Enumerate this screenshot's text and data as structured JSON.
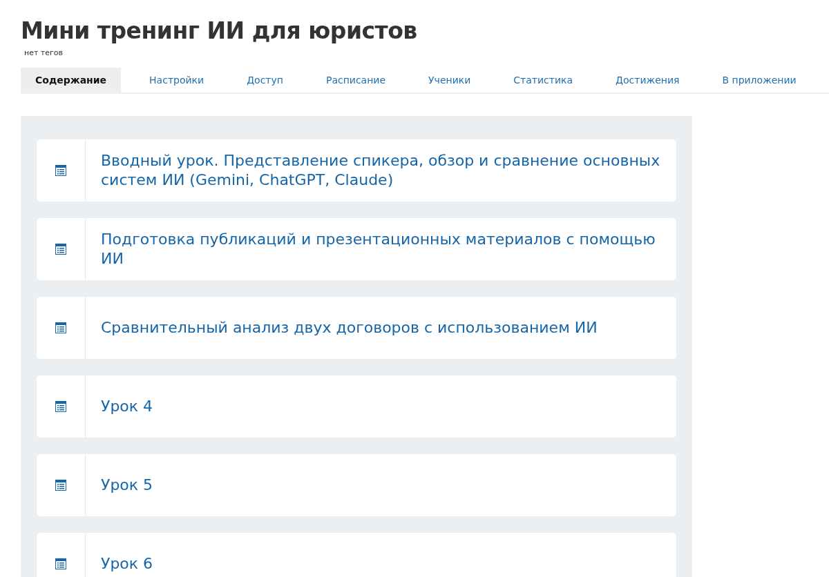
{
  "title": "Мини тренинг ИИ для юристов",
  "tags": "нет тегов",
  "tabs": [
    {
      "label": "Содержание",
      "selected": true
    },
    {
      "label": "Настройки",
      "selected": false
    },
    {
      "label": "Доступ",
      "selected": false
    },
    {
      "label": "Расписание",
      "selected": false
    },
    {
      "label": "Ученики",
      "selected": false
    },
    {
      "label": "Статистика",
      "selected": false
    },
    {
      "label": "Достижения",
      "selected": false
    },
    {
      "label": "В приложении",
      "selected": false
    }
  ],
  "lessons": [
    {
      "title": "Вводный урок. Представление спикера, обзор и сравнение основных систем ИИ (Gemini, ChatGPT, Claude)"
    },
    {
      "title": "Подготовка публикаций и презентационных материалов с помощью ИИ"
    },
    {
      "title": "Сравнительный анализ двух договоров с использованием ИИ"
    },
    {
      "title": "Урок 4"
    },
    {
      "title": "Урок 5"
    },
    {
      "title": "Урок 6"
    }
  ]
}
